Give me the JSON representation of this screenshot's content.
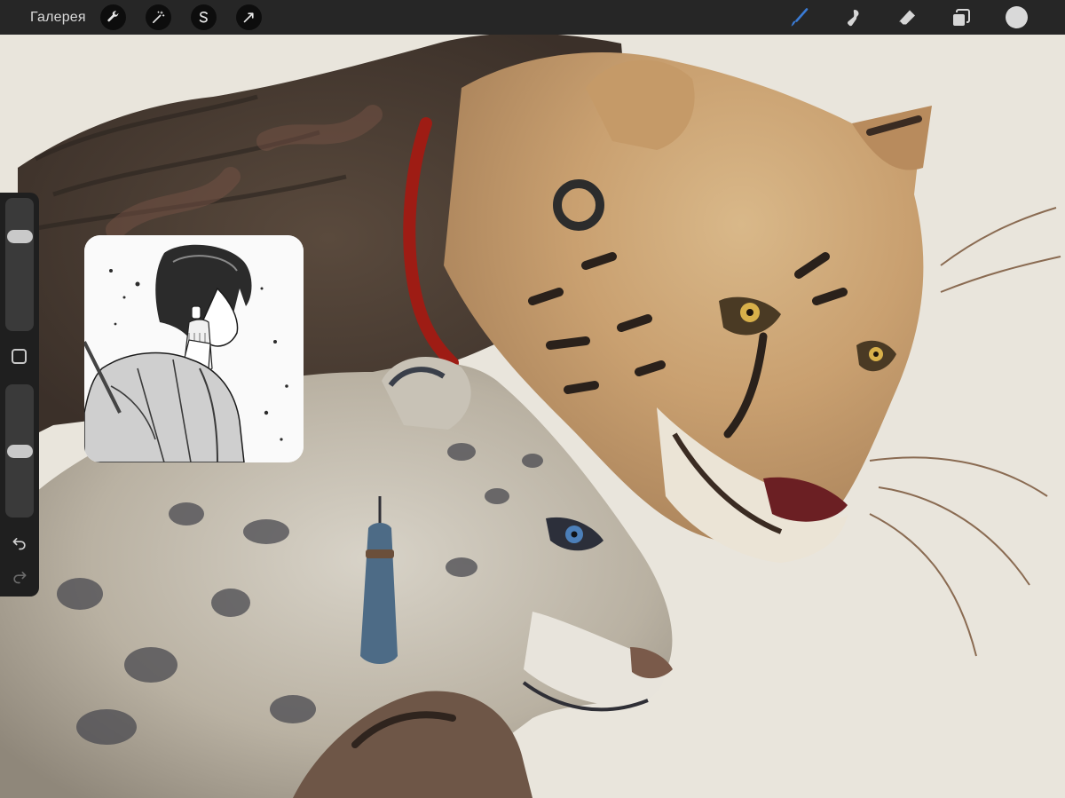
{
  "toolbar": {
    "gallery_label": "Галерея",
    "left_tools": [
      {
        "name": "wrench-icon",
        "action": "actions"
      },
      {
        "name": "magic-wand-icon",
        "action": "adjustments"
      },
      {
        "name": "selection-s-icon",
        "action": "selection"
      },
      {
        "name": "arrow-cursor-icon",
        "action": "transform"
      }
    ],
    "right_tools": [
      {
        "name": "brush-icon",
        "active": true
      },
      {
        "name": "smudge-icon",
        "active": false
      },
      {
        "name": "eraser-icon",
        "active": false
      },
      {
        "name": "layers-icon",
        "active": false
      }
    ],
    "active_color": "#d9d9d9",
    "accent_color": "#3a7bd5"
  },
  "sidebar": {
    "brush_size_level": 0.75,
    "opacity_level": 0.5,
    "icons": [
      "square-modify-icon",
      "undo-icon",
      "redo-icon"
    ]
  },
  "reference": {
    "type": "manga-character-reference"
  },
  "colors": {
    "toolbar_bg": "#262626",
    "canvas_bg": "#e9e5dc",
    "sidebar_bg": "#1f1f1f"
  }
}
